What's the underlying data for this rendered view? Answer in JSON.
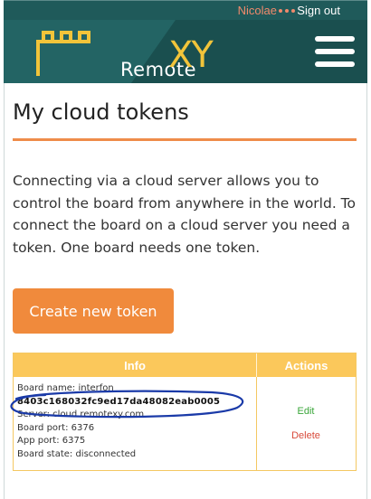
{
  "topbar": {
    "user_name": "Nicolae",
    "sign_out": "Sign out"
  },
  "header": {
    "logo_text": "Remote",
    "logo_accent": "XY",
    "icons": [
      "remotexy-logo-icon",
      "hamburger-menu-icon",
      "user-menu-dots-icon"
    ]
  },
  "page": {
    "title": "My cloud tokens",
    "intro": "Connecting via a cloud server allows you to control the board from anywhere in the world. To connect the board on a cloud server you need a token. One board needs one token.",
    "create_button": "Create new token"
  },
  "table": {
    "headers": {
      "info": "Info",
      "actions": "Actions"
    },
    "rows": [
      {
        "board_name": "Board name: interfon",
        "token": "8403c168032fc9ed17da48082eab0005",
        "server": "Server: cloud.remotexy.com",
        "board_port": "Board port: 6376",
        "app_port": "App port: 6375",
        "board_state": "Board state: disconnected",
        "edit": "Edit",
        "delete": "Delete"
      }
    ]
  },
  "colors": {
    "header_bg": "#236464",
    "accent_orange": "#f08a3c",
    "table_header": "#fbc85b",
    "logo_yellow": "#f2c43a",
    "edit_green": "#3aa63a",
    "delete_red": "#d84a3a",
    "annotation_blue": "#1a3aa8"
  }
}
